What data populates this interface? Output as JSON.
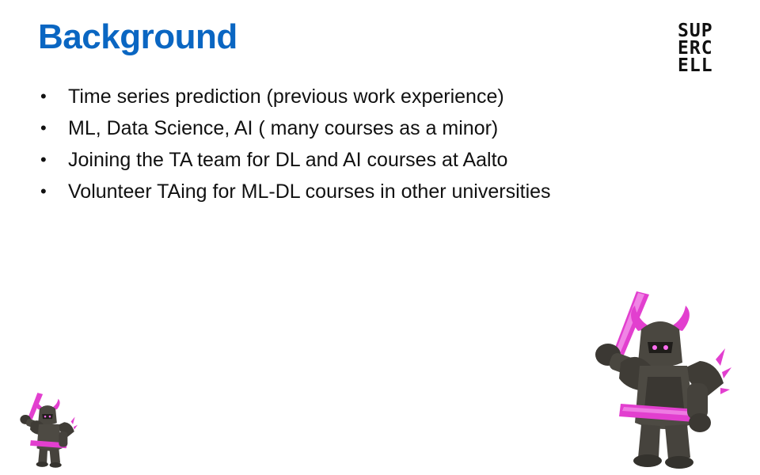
{
  "slide": {
    "title": "Background",
    "logo": {
      "lines": [
        "SUP",
        "ERC",
        "ELL"
      ],
      "brand_color": "#111111"
    },
    "bullets": [
      "Time series prediction (previous work experience)",
      "ML, Data Science, AI ( many courses as a minor)",
      "Joining the TA team for DL and AI courses at Aalto",
      "Volunteer TAing for ML-DL courses in other universities"
    ],
    "bullet_symbol": "•",
    "illustrations": [
      "pekka-character",
      "pekka-character-small"
    ]
  },
  "colors": {
    "title": "#0a66c2",
    "text": "#111111",
    "accent_pink": "#e23fcf",
    "armor": "#4a4740"
  }
}
